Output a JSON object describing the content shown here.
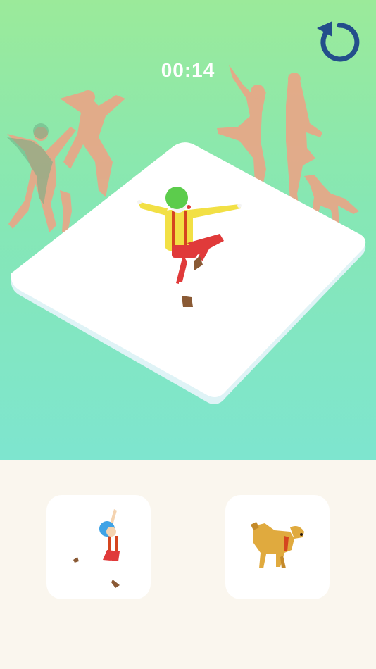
{
  "hud": {
    "timer": "00:14"
  },
  "icons": {
    "restart": "restart-icon"
  },
  "colors": {
    "accent": "#234e8b",
    "sky_top": "#9bea9a",
    "sky_bottom": "#7ee5cf",
    "silhouette": "#f0a184",
    "tray": "#faf6ee"
  },
  "options": [
    {
      "name": "ballerina-pose-card"
    },
    {
      "name": "dog-pose-card"
    }
  ]
}
